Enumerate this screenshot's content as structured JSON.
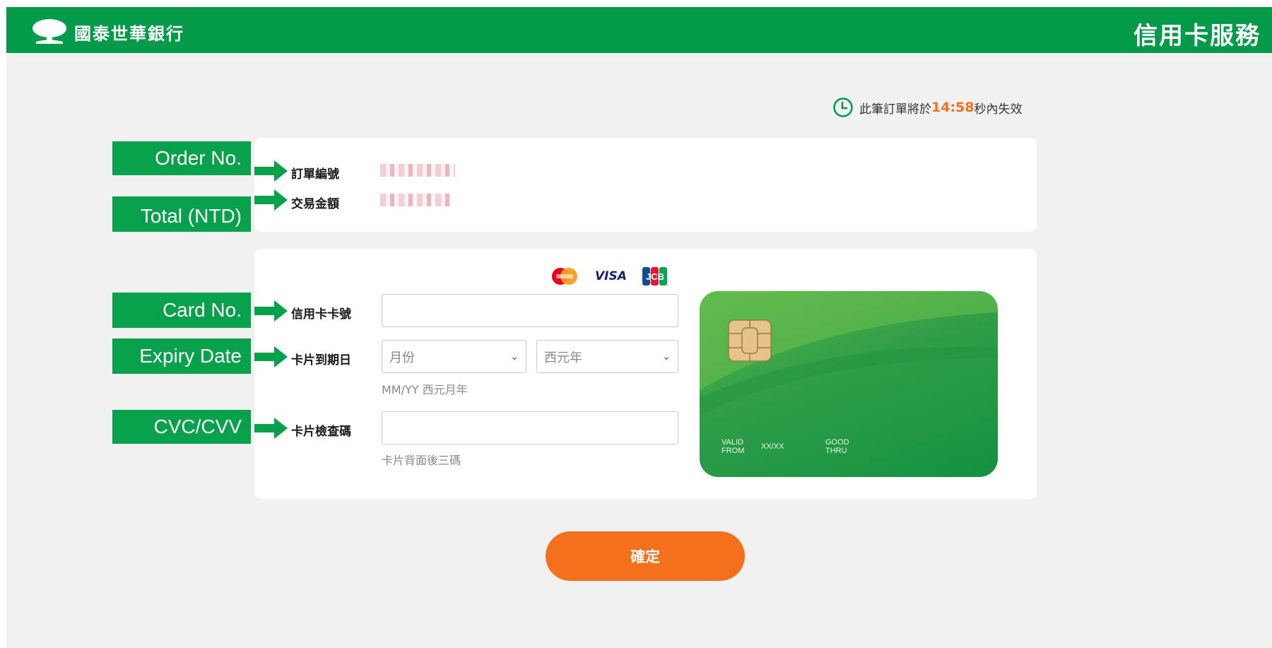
{
  "header": {
    "bank_name": "國泰世華銀行",
    "service_title": "信用卡服務"
  },
  "timer": {
    "prefix": "此筆訂單將於",
    "countdown": "14:58",
    "suffix": "秒內失效"
  },
  "order": {
    "order_no_label": "訂單編號",
    "total_label": "交易金額"
  },
  "payment": {
    "card_logos": {
      "mastercard": "MasterCard",
      "visa": "VISA",
      "jcb": "JCB"
    },
    "card_no_label": "信用卡卡號",
    "expiry_label": "卡片到期日",
    "month_placeholder": "月份",
    "year_placeholder": "西元年",
    "expiry_hint": "MM/YY 西元月年",
    "cvc_label": "卡片檢查碼",
    "cvc_hint": "卡片背面後三碼"
  },
  "card_preview": {
    "valid_from": "VALID\nFROM",
    "valid_value": "XX/XX",
    "good_thru": "GOOD\nTHRU"
  },
  "annotations": {
    "order_no": "Order No.",
    "total": "Total (NTD)",
    "card_no": "Card No.",
    "expiry": "Expiry Date",
    "cvc": "CVC/CVV"
  },
  "confirm_label": "確定",
  "colors": {
    "brand_green": "#039a4a",
    "accent_orange": "#f4701d",
    "page_bg": "#f1f1f1"
  }
}
